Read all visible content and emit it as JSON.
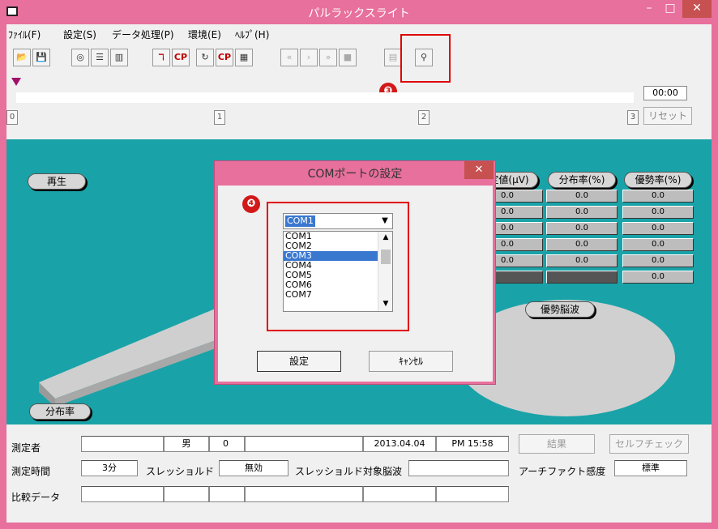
{
  "window": {
    "title": "パルラックスライト",
    "min_glyph": "–",
    "max_glyph": "□",
    "close_glyph": "✕"
  },
  "menu": [
    "ﾌｧｲﾙ(F)",
    "設定(S)",
    "データ処理(P)",
    "環境(E)",
    "ﾍﾙﾌﾟ(H)"
  ],
  "toolbar": {
    "icons": [
      "open-folder-icon",
      "save-icon",
      "person-icon",
      "list-icon",
      "bar-chart-icon",
      "filter-icon",
      "cp-icon",
      "refresh-icon",
      "cp-refresh-icon",
      "group-icon",
      "rewind-icon",
      "play-icon",
      "fast-forward-icon",
      "stop-icon",
      "print-icon",
      "probe-icon"
    ],
    "glyphs": [
      "📂",
      "💾",
      "◎",
      "☰",
      "▥",
      "ℸ",
      "CP",
      "↻",
      "CP",
      "▦",
      "«",
      "›",
      "»",
      "■",
      "▤",
      "⚲"
    ]
  },
  "timeline": {
    "ticks": [
      "0",
      "1",
      "2",
      "3"
    ],
    "time": "00:00",
    "reset_label": "リセット"
  },
  "annotations": {
    "badge3": "❸",
    "badge4": "❹"
  },
  "panel": {
    "play_label": "再生",
    "distribution_label": "分布率",
    "dominant_wave_label": "優勢脳波",
    "headers": [
      "測定値(μV)",
      "分布率(%)",
      "優勢率(%)"
    ],
    "rows": [
      [
        "0.0",
        "0.0",
        "0.0"
      ],
      [
        "0.0",
        "0.0",
        "0.0"
      ],
      [
        "0.0",
        "0.0",
        "0.0"
      ],
      [
        "0.0",
        "0.0",
        "0.0"
      ],
      [
        "0.0",
        "0.0",
        "0.0"
      ],
      [
        "",
        "",
        "0.0"
      ]
    ]
  },
  "bottom": {
    "measurer_label": "測定者",
    "gender": "男",
    "age": "0",
    "date": "2013.04.04",
    "time": "PM 15:58",
    "result_label": "結果",
    "selfcheck_label": "セルフチェック",
    "duration_label": "測定時間",
    "duration_value": "3分",
    "threshold_label": "スレッショルド",
    "threshold_value": "無効",
    "threshold_target_label": "スレッショルド対象脳波",
    "artifact_label": "アーチファクト感度",
    "artifact_value": "標準",
    "compare_label": "比較データ"
  },
  "dialog": {
    "title": "COMポートの設定",
    "close_glyph": "✕",
    "selected": "COM1",
    "options": [
      "COM1",
      "COM2",
      "COM3",
      "COM4",
      "COM5",
      "COM6",
      "COM7"
    ],
    "highlighted": "COM3",
    "ok_label": "設定",
    "cancel_label": "ｷｬﾝｾﾙ"
  },
  "colors": {
    "frame": "#e8709c",
    "panel": "#19a3a8",
    "highlight": "#e00000",
    "selection": "#3a78d0"
  }
}
